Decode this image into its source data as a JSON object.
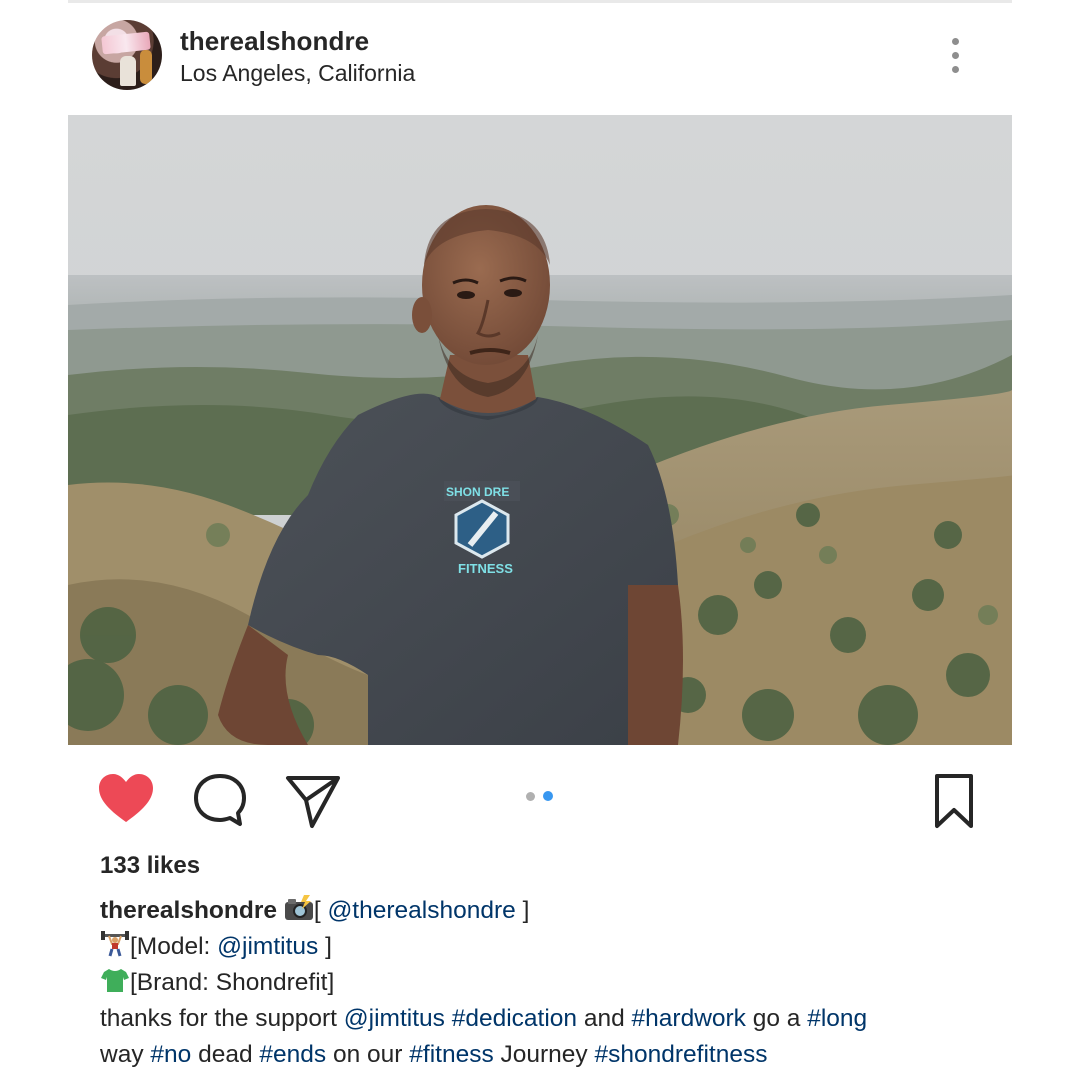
{
  "post": {
    "username": "therealshondre",
    "location": "Los Angeles, California",
    "likes": "133 likes"
  },
  "caption": {
    "author": "therealshondre",
    "line1": {
      "open": "[ ",
      "mention": "@therealshondre",
      "close": " ]"
    },
    "line2": {
      "prefix": "[Model: ",
      "mention": "@jimtitus",
      "close": " ]"
    },
    "line3": {
      "text": "[Brand: Shondrefit]"
    },
    "line4": {
      "t1": "thanks for the support ",
      "mention": "@jimtitus",
      "sp1": " ",
      "tag1": "#dedication",
      "t2": " and ",
      "tag2": "#hardwork",
      "t3": " go a ",
      "tag3": "#long"
    },
    "line5": {
      "t1": "way ",
      "tag1": "#no",
      "t2": " dead ",
      "tag2": "#ends",
      "t3": " on our ",
      "tag3": "#fitness",
      "t4": " Journey ",
      "tag4": "#shondrefitness"
    }
  },
  "shirt_logo": {
    "top": "SHON DRE",
    "bottom": "FITNESS"
  },
  "carousel": {
    "total": 2,
    "active": 2
  },
  "icons": {
    "like": "heart-icon",
    "comment": "comment-icon",
    "share": "paper-plane-icon",
    "save": "bookmark-icon",
    "more": "more-options-icon",
    "camera": "camera-flash-emoji",
    "weightlifter": "weightlifter-emoji",
    "shirt": "tshirt-emoji"
  },
  "colors": {
    "heart": "#ed4956",
    "link": "#003569",
    "active_dot": "#3897f0"
  }
}
